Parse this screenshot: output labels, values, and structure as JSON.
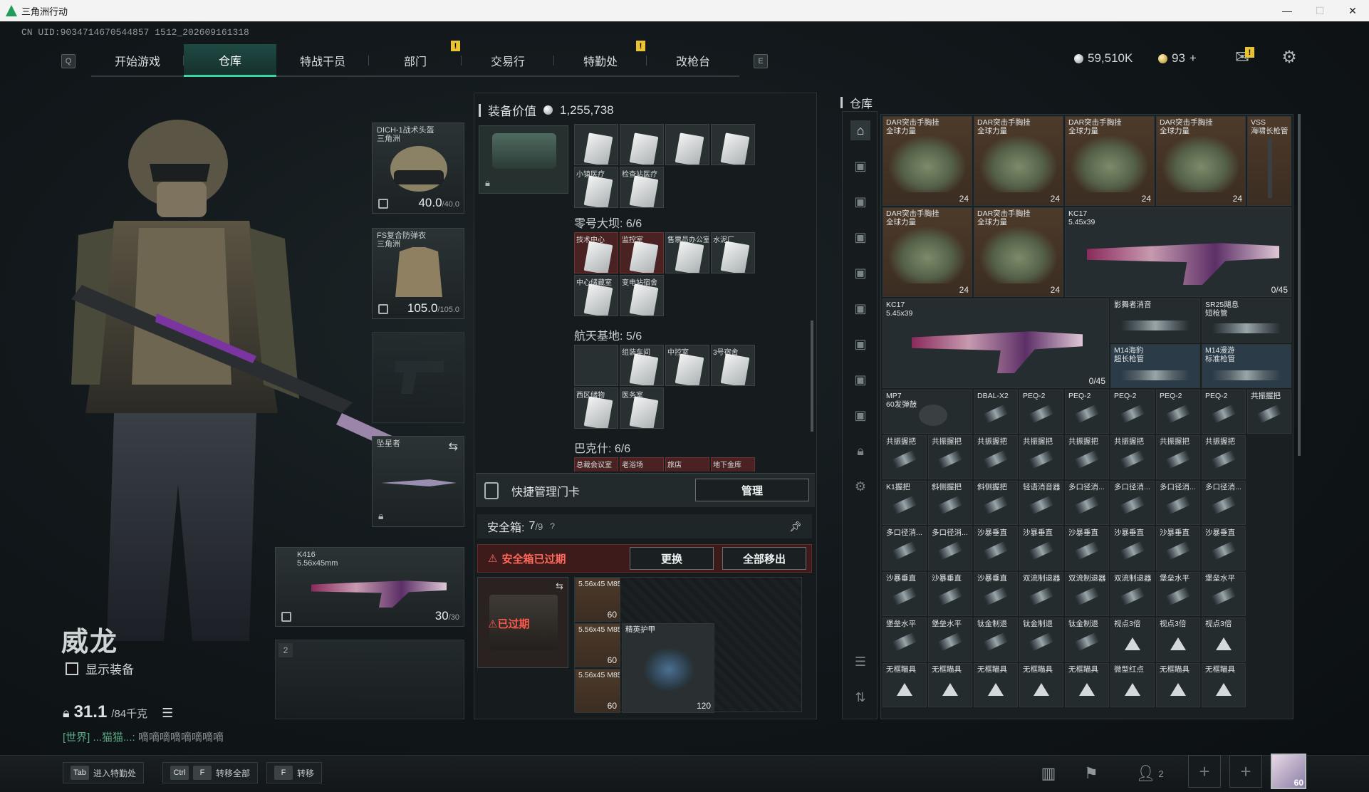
{
  "window": {
    "title": "三角洲行动"
  },
  "uid": "CN UID:9034714670544857 1512_202609161318",
  "nav": {
    "left_key": "Q",
    "right_key": "E",
    "tabs": [
      {
        "label": "开始游戏"
      },
      {
        "label": "仓库",
        "active": true
      },
      {
        "label": "特战干员"
      },
      {
        "label": "部门",
        "alert": "!"
      },
      {
        "label": "交易行"
      },
      {
        "label": "特勤处",
        "alert": "!"
      },
      {
        "label": "改枪台"
      }
    ]
  },
  "currency": {
    "silver": "59,510K",
    "gold": "93",
    "gold_add": "+"
  },
  "mail_alert": "!",
  "character": {
    "name": "威龙",
    "show_equipment_label": "显示装备",
    "weight_current": "31.1",
    "weight_max": "/84千克",
    "chat_channel": "[世界]",
    "chat_user": "...猫猫...:",
    "chat_message": "嘀嘀嘀嘀嘀嘀嘀嘀"
  },
  "equipment": {
    "helmet": {
      "name": "DICH-1战术头盔",
      "sub": "三角洲",
      "dur": "40.0",
      "dur_max": "/40.0"
    },
    "armor": {
      "name": "FS复合防弹衣",
      "sub": "三角洲",
      "dur": "105.0",
      "dur_max": "/105.0"
    },
    "melee": {
      "name": "坠星者"
    },
    "primary": {
      "slot": "1",
      "name": "K416",
      "caliber": "5.56x45mm",
      "ammo": "30",
      "ammo_max": "/30"
    },
    "secondary": {
      "slot": "2"
    }
  },
  "keys_panel": {
    "title": "装备价值",
    "value": "1,255,738",
    "top_row_labels": [
      "",
      "",
      "",
      ""
    ],
    "row2_labels": [
      "小镇医疗",
      "检查站医疗"
    ],
    "maps": [
      {
        "name": "零号大坝: 6/6",
        "row1": [
          "技术中心",
          "监控室",
          "售票员办公室",
          "水泥厂"
        ],
        "row2": [
          "中心储藏室",
          "变电站宿舍"
        ]
      },
      {
        "name": "航天基地: 5/6",
        "row1": [
          "",
          "组装车间",
          "中控室",
          "3号宿舍"
        ],
        "row2": [
          "西区储物",
          "医务室"
        ]
      },
      {
        "name": "巴克什: 6/6",
        "row1": [
          "总裁会议室",
          "老浴场",
          "旅店",
          "地下金库"
        ]
      }
    ],
    "quick_card_label": "快捷管理门卡",
    "manage_button": "管理"
  },
  "safebox": {
    "label": "安全箱:",
    "count": "7",
    "count_max": "/9",
    "help": "?",
    "expired_warning": "安全箱已过期",
    "replace_button": "更换",
    "move_all_button": "全部移出",
    "expired_overlay": "已过期",
    "items": [
      {
        "name": "5.56x45 M855A1",
        "count": "60"
      },
      {
        "name": "5.56x45 M855A1",
        "count": "60"
      },
      {
        "name": "5.56x45 M855A1",
        "count": "60"
      },
      {
        "name": "精英护甲",
        "count": "120"
      }
    ]
  },
  "warehouse": {
    "title": "仓库",
    "cells": [
      {
        "name": "DAR突击手胸挂",
        "sub": "全球力量",
        "count": "24",
        "type": "bag"
      },
      {
        "name": "DAR突击手胸挂",
        "sub": "全球力量",
        "count": "24",
        "type": "bag"
      },
      {
        "name": "DAR突击手胸挂",
        "sub": "全球力量",
        "count": "24",
        "type": "bag"
      },
      {
        "name": "DAR突击手胸挂",
        "sub": "全球力量",
        "count": "24",
        "type": "bag"
      },
      {
        "name": "VSS",
        "sub": "海啸长枪管",
        "count": "",
        "type": "barrel"
      },
      {
        "name": "DAR突击手胸挂",
        "sub": "全球力量",
        "count": "24",
        "type": "bag"
      },
      {
        "name": "DAR突击手胸挂",
        "sub": "全球力量",
        "count": "24",
        "type": "bag"
      },
      {
        "name": "KC17",
        "sub": "5.45x39",
        "count": "0/45",
        "type": "gun"
      },
      {
        "name": "KC17",
        "sub": "5.45x39",
        "count": "0/45",
        "type": "gun"
      },
      {
        "name": "影舞者消音",
        "sub": "",
        "count": "",
        "type": "attach"
      },
      {
        "name": "SR25飓息",
        "sub": "短枪管",
        "count": "",
        "type": "attach"
      },
      {
        "name": "M14海豹",
        "sub": "超长枪管",
        "count": "",
        "type": "attach"
      },
      {
        "name": "M14漫游",
        "sub": "标准枪管",
        "count": "",
        "type": "attach"
      },
      {
        "name": "MP7",
        "sub": "60发弹鼓",
        "count": "",
        "type": "attach"
      },
      {
        "name": "DBAL-X2",
        "sub": "",
        "count": "",
        "type": "attach"
      },
      {
        "name": "PEQ-2",
        "sub": "",
        "count": "",
        "type": "attach"
      },
      {
        "name": "PEQ-2",
        "sub": "",
        "count": "",
        "type": "attach"
      },
      {
        "name": "PEQ-2",
        "sub": "",
        "count": "",
        "type": "attach"
      },
      {
        "name": "PEQ-2",
        "sub": "",
        "count": "",
        "type": "attach"
      },
      {
        "name": "PEQ-2",
        "sub": "",
        "count": "",
        "type": "attach"
      },
      {
        "name": "共振握把",
        "sub": "",
        "count": "",
        "type": "attach"
      }
    ],
    "grid_rows": [
      [
        "共振握把",
        "共振握把",
        "共振握把",
        "共振握把",
        "共振握把",
        "共振握把",
        "共振握把",
        "共振握把"
      ],
      [
        "K1握把",
        "斜侧握把",
        "斜侧握把",
        "轻语消音器",
        "多口径消...",
        "多口径消...",
        "多口径消...",
        "多口径消..."
      ],
      [
        "多口径消...",
        "多口径消...",
        "沙暴垂直",
        "沙暴垂直",
        "沙暴垂直",
        "沙暴垂直",
        "沙暴垂直",
        "沙暴垂直"
      ],
      [
        "沙暴垂直",
        "沙暴垂直",
        "沙暴垂直",
        "双流制退器",
        "双流制退器",
        "双流制退器",
        "堡垒水平",
        "堡垒水平"
      ],
      [
        "堡垒水平",
        "堡垒水平",
        "钛金制退",
        "钛金制退",
        "钛金制退",
        "视点3倍",
        "视点3倍",
        "视点3倍"
      ],
      [
        "无框瞄具",
        "无框瞄具",
        "无框瞄具",
        "无框瞄具",
        "无框瞄具",
        "微型红点",
        "无框瞄具",
        "无框瞄具"
      ]
    ]
  },
  "bottom": {
    "hints": [
      {
        "keys": [
          "Tab"
        ],
        "label": "进入特勤处"
      },
      {
        "keys": [
          "Ctrl",
          "F"
        ],
        "label": "转移全部"
      },
      {
        "keys": [
          "F"
        ],
        "label": "转移"
      }
    ],
    "friends_count": "2",
    "level": "60"
  }
}
